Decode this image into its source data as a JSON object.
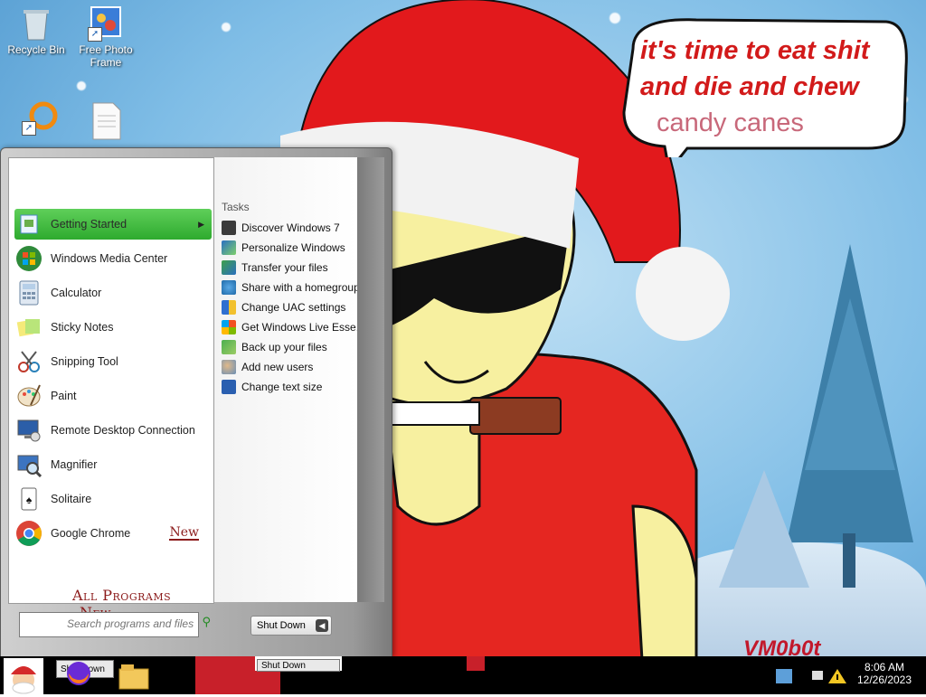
{
  "desktop": {
    "icons": [
      {
        "label": "Recycle Bin",
        "icon": "recycle-bin-icon"
      },
      {
        "label": "Free Photo\nFrame",
        "icon": "photo-frame-icon"
      },
      {
        "label": "",
        "icon": "orange-ring-icon"
      },
      {
        "label": "",
        "icon": "document-icon"
      }
    ],
    "wallpaper": {
      "speech_line1": "it's time to eat shit",
      "speech_line2": "and die and chew",
      "speech_line3": "candy canes",
      "signature": "VM0b0t"
    }
  },
  "start_menu": {
    "programs": [
      {
        "label": "Getting Started",
        "icon": "getting-started-icon",
        "highlighted": true
      },
      {
        "label": "Windows Media Center",
        "icon": "windows-logo-icon"
      },
      {
        "label": "Calculator",
        "icon": "calculator-icon"
      },
      {
        "label": "Sticky Notes",
        "icon": "sticky-notes-icon"
      },
      {
        "label": "Snipping Tool",
        "icon": "scissors-icon"
      },
      {
        "label": "Paint",
        "icon": "paint-palette-icon"
      },
      {
        "label": "Remote Desktop Connection",
        "icon": "remote-desktop-icon"
      },
      {
        "label": "Magnifier",
        "icon": "magnifier-icon"
      },
      {
        "label": "Solitaire",
        "icon": "solitaire-icon"
      },
      {
        "label": "Google Chrome",
        "icon": "chrome-icon",
        "badge": "New"
      }
    ],
    "all_programs": "All Programs",
    "all_programs_badge": "New",
    "tasks_title": "Tasks",
    "tasks": [
      {
        "label": "Discover Windows 7",
        "icon": "monitor-icon"
      },
      {
        "label": "Personalize Windows",
        "icon": "personalize-icon"
      },
      {
        "label": "Transfer your files",
        "icon": "transfer-icon"
      },
      {
        "label": "Share with a homegroup",
        "icon": "homegroup-icon"
      },
      {
        "label": "Change UAC settings",
        "icon": "uac-shield-icon"
      },
      {
        "label": "Get Windows Live Esse...",
        "icon": "windows-flag-icon"
      },
      {
        "label": "Back up your files",
        "icon": "backup-icon"
      },
      {
        "label": "Add new users",
        "icon": "users-icon"
      },
      {
        "label": "Change text size",
        "icon": "text-size-icon"
      }
    ],
    "search_placeholder": "Search programs and files",
    "shutdown_label": "Shut Down"
  },
  "taskbar": {
    "buttons": [
      "Shut Down",
      "Shut Down"
    ],
    "clock_time": "8:06 AM",
    "clock_date": "12/26/2023"
  },
  "colors": {
    "highlight_green": "#2eaa2e",
    "accent_red": "#c8202a",
    "new_badge": "#8b1a1a"
  }
}
